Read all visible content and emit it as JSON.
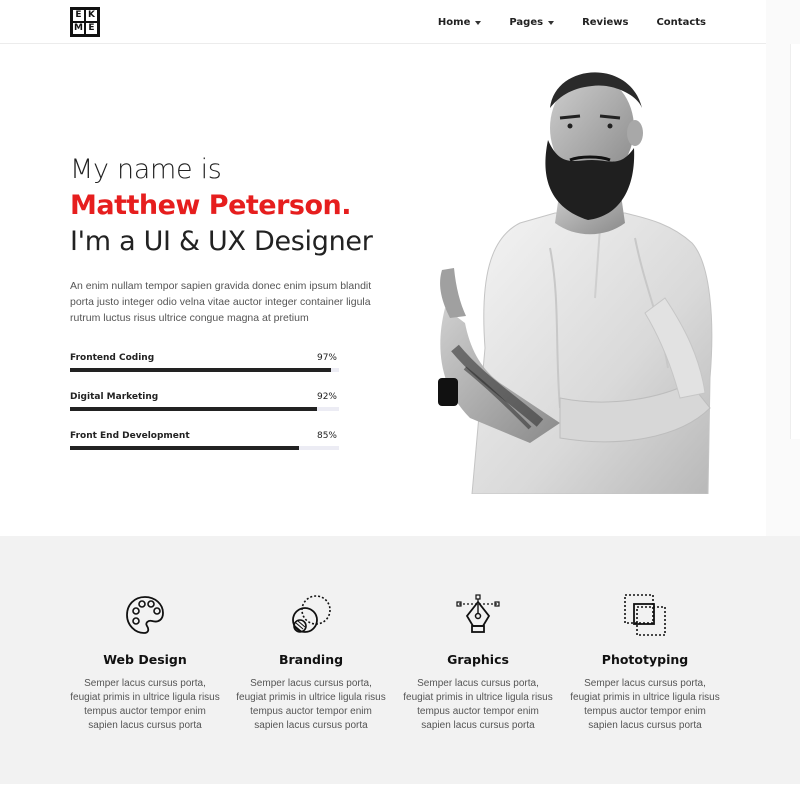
{
  "header": {
    "logo_letters": [
      "E",
      "K",
      "M",
      "E"
    ],
    "nav": [
      {
        "label": "Home",
        "has_dropdown": true
      },
      {
        "label": "Pages",
        "has_dropdown": true
      },
      {
        "label": "Reviews",
        "has_dropdown": false
      },
      {
        "label": "Contacts",
        "has_dropdown": false
      }
    ]
  },
  "hero": {
    "intro": "My name is",
    "name": "Matthew Peterson.",
    "role": "I'm a UI & UX Designer",
    "description": "An enim nullam tempor sapien gravida donec enim ipsum blandit porta justo integer odio velna vitae auctor integer container ligula rutrum luctus risus ultrice congue magna at pretium",
    "skills": [
      {
        "label": "Frontend Coding",
        "percent_label": "97%",
        "value": 97
      },
      {
        "label": "Digital Marketing",
        "percent_label": "92%",
        "value": 92
      },
      {
        "label": "Front End Development",
        "percent_label": "85%",
        "value": 85
      }
    ]
  },
  "services": [
    {
      "title": "Web Design",
      "icon": "palette-icon",
      "text": "Semper lacus cursus porta, feugiat primis in ultrice ligula risus tempus auctor tempor enim sapien lacus cursus porta"
    },
    {
      "title": "Branding",
      "icon": "branding-circles-icon",
      "text": "Semper lacus cursus porta, feugiat primis in ultrice ligula risus tempus auctor tempor enim sapien lacus cursus porta"
    },
    {
      "title": "Graphics",
      "icon": "pen-tool-icon",
      "text": "Semper lacus cursus porta, feugiat primis in ultrice ligula risus tempus auctor tempor enim sapien lacus cursus porta"
    },
    {
      "title": "Phototyping",
      "icon": "prototype-squares-icon",
      "text": "Semper lacus cursus porta, feugiat primis in ultrice ligula risus tempus auctor tempor enim sapien lacus cursus porta"
    }
  ],
  "colors": {
    "accent": "#e61e1e",
    "text": "#222222",
    "services_bg": "#f2f2f2",
    "bar_track": "#ececf4",
    "bar_fill": "#222222"
  }
}
